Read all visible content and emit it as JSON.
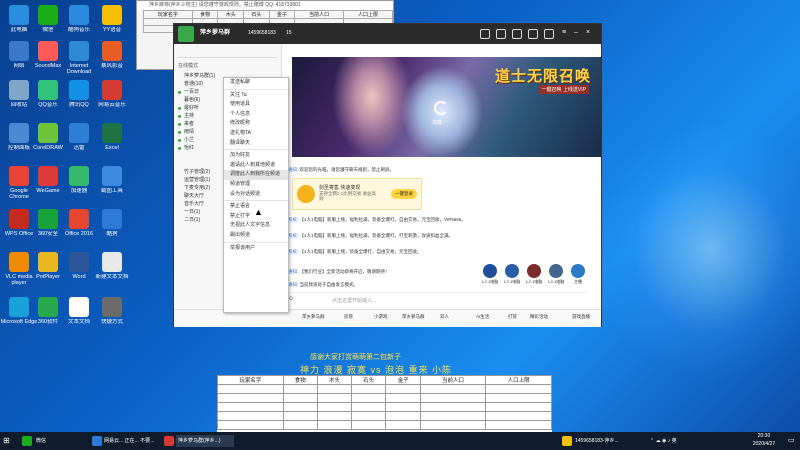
{
  "desktop": {
    "icons": [
      {
        "label": "此电脑",
        "color": "#2a8ee0"
      },
      {
        "label": "网络",
        "color": "#3a78c8"
      },
      {
        "label": "回收站",
        "color": "#7fa6c9"
      },
      {
        "label": "控制面板",
        "color": "#4a8ad4"
      },
      {
        "label": "Google Chrome",
        "color": "#e94335"
      },
      {
        "label": "WPS Office",
        "color": "#c42b1c"
      },
      {
        "label": "VLC media player",
        "color": "#f08a00"
      },
      {
        "label": "Microsoft Edge",
        "color": "#1aa2d8"
      },
      {
        "label": "微信",
        "color": "#1aad19"
      },
      {
        "label": "SoundMax",
        "color": "#ff5a5a"
      },
      {
        "label": "QQ音乐",
        "color": "#31c27c"
      },
      {
        "label": "CorelDRAW",
        "color": "#6ec43a"
      },
      {
        "label": "WeGame",
        "color": "#dd3b3b"
      },
      {
        "label": "360安全",
        "color": "#1aa23a"
      },
      {
        "label": "PotPlayer",
        "color": "#e9b820"
      },
      {
        "label": "360软件",
        "color": "#27a94e"
      },
      {
        "label": "酷狗音乐",
        "color": "#2c8bde"
      },
      {
        "label": "Internet Download",
        "color": "#2e8bd2"
      },
      {
        "label": "腾讯QQ",
        "color": "#1290e3"
      },
      {
        "label": "迅雷",
        "color": "#2b7fd6"
      },
      {
        "label": "加速器",
        "color": "#34b86a"
      },
      {
        "label": "Office 2016",
        "color": "#e6462d"
      },
      {
        "label": "Word",
        "color": "#2b579a"
      },
      {
        "label": "文本文档",
        "color": "#ffffff"
      },
      {
        "label": "YY语音",
        "color": "#f6c000"
      },
      {
        "label": "暴风影音",
        "color": "#e85d24"
      },
      {
        "label": "网易云音乐",
        "color": "#d43c33"
      },
      {
        "label": "Excel",
        "color": "#1f7244"
      },
      {
        "label": "截图工具",
        "color": "#3c8ae0"
      },
      {
        "label": "酷狗",
        "color": "#2e7ad9"
      },
      {
        "label": "新建文本文档",
        "color": "#e8e8e8"
      },
      {
        "label": "快捷方式",
        "color": "#6b6b6b"
      }
    ]
  },
  "topwin": {
    "title": "萍乡麻将(萍乡斗地主)  请您遵守游戏规则，禁止赌博  QQ: 418733801",
    "headers": [
      "玩家名字",
      "食物",
      "木头",
      "石头",
      "金子",
      "当前人口",
      "人口上限"
    ]
  },
  "main": {
    "room_name": "萍乡萝马群",
    "user_id": "1459658183",
    "online_count": "15",
    "side_header": "在线模式",
    "side_groups": [
      {
        "label": "萍乡萝马群(1)",
        "dot": false
      },
      {
        "label": "普通(10)",
        "dot": false
      },
      {
        "label": "一百日",
        "dot": true
      },
      {
        "label": "暮色(6)",
        "dot": false
      },
      {
        "label": "最好听",
        "dot": true
      },
      {
        "label": "主持",
        "dot": true
      },
      {
        "label": "来者",
        "dot": true
      },
      {
        "label": "雨情",
        "dot": true
      },
      {
        "label": "小兰",
        "dot": true
      },
      {
        "label": "怡红",
        "dot": true
      },
      {
        "label": "",
        "dot": false
      },
      {
        "label": "",
        "dot": false
      },
      {
        "label": "竹子管理(2)",
        "dot": false
      },
      {
        "label": "运营管理(1)",
        "dot": false
      },
      {
        "label": "下麦专用(2)",
        "dot": false
      },
      {
        "label": "聊天大厅",
        "dot": false
      },
      {
        "label": "音乐大厅",
        "dot": false
      },
      {
        "label": "一日(1)",
        "dot": false
      },
      {
        "label": "二日(1)",
        "dot": false
      }
    ],
    "banner": {
      "game_title": "道士无限召唤",
      "game_sub": "一键召唤  上线送VIP",
      "loading": "加载"
    },
    "messages": [
      {
        "name": "通知:",
        "text": "欢迎您的光临，请您遵守聊天规则，禁止刷屏。"
      },
      {
        "name": "系统:",
        "text": "【1人1电脑】新服上线，福利拉满，装备全爆打，自由交易，元宝回收，VIP6666。"
      },
      {
        "name": "系统:",
        "text": "【1人1电脑】新服上线，福利拉满，装备全爆打，打宝刺激，攻速扣血全满。"
      },
      {
        "name": "系统:",
        "text": "【1人1电脑】新服上线，装备全爆打，自由交易，元宝回收。"
      },
      {
        "name": "通知:",
        "text": "【我们行业】全新活动即将开启，敬请期待！"
      },
      {
        "name": "通知:",
        "text": "当前频道处于自由发言模式。"
      }
    ],
    "ad": {
      "title": "剑圣寄售 快速变现",
      "desc": "支持全网1:1比例交易 收益高效",
      "button": "一键登录"
    },
    "avatars": [
      {
        "label": "1人1电脑",
        "color": "#1e4e9a"
      },
      {
        "label": "1人1电脑",
        "color": "#2a5ca8"
      },
      {
        "label": "1人1电脑",
        "color": "#7a2c2c"
      },
      {
        "label": "1人1电脑",
        "color": "#44668e"
      },
      {
        "label": "主播",
        "color": "#2a7ac8"
      }
    ],
    "input_placeholder": "点击这里开始输入...",
    "bottom_items": [
      "萍乡萝马群",
      "房管",
      "小游戏",
      "萍乡萝马群",
      "双人",
      "AI生活",
      "打赏",
      "精彩活动",
      "游戏直播"
    ]
  },
  "context_menu": {
    "items": [
      "发送私聊",
      "关注 Ta",
      "使用道具",
      "个人信息",
      "修改昵称",
      "送礼物TA",
      "翻译聊天",
      "加为好友",
      "邀请此人到其他频道",
      "调度此人到我所在频道",
      "频道管理",
      "设为对话频道",
      "禁止语言",
      "禁止打字",
      "无视此人文字信息",
      "踢出频道",
      "举报该用户"
    ],
    "highlighted_index": 9
  },
  "overlay": {
    "line1": "感谢大家打赏萌萌第二包新子",
    "line2": "神力 浪漫 寂寞 vs 泡泡 重来 小陈"
  },
  "bottom_table": {
    "headers": [
      "玩家名字",
      "食物",
      "木头",
      "石头",
      "金子",
      "当前人口",
      "人口上限"
    ]
  },
  "taskbar": {
    "search": "微信",
    "tasks": [
      "网易云... 正在... 不要...",
      "萍乡萝马群(萍乡...)"
    ],
    "tray_text": "1459658183-萍乡...",
    "time": "20:30",
    "date": "2020/4/27"
  }
}
